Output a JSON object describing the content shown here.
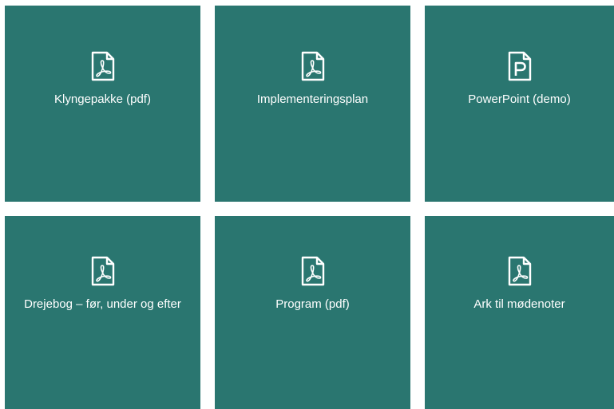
{
  "tiles": [
    {
      "label": "Klyngepakke (pdf)",
      "icon": "pdf-file-icon"
    },
    {
      "label": "Implementeringsplan",
      "icon": "pdf-file-icon"
    },
    {
      "label": "PowerPoint (demo)",
      "icon": "powerpoint-file-icon"
    },
    {
      "label": "Drejebog – før, under og efter",
      "icon": "pdf-file-icon"
    },
    {
      "label": "Program (pdf)",
      "icon": "pdf-file-icon"
    },
    {
      "label": "Ark til mødenoter",
      "icon": "pdf-file-icon"
    }
  ],
  "colors": {
    "tile_background": "#2a7670",
    "text": "#ffffff",
    "page_background": "#ffffff"
  }
}
